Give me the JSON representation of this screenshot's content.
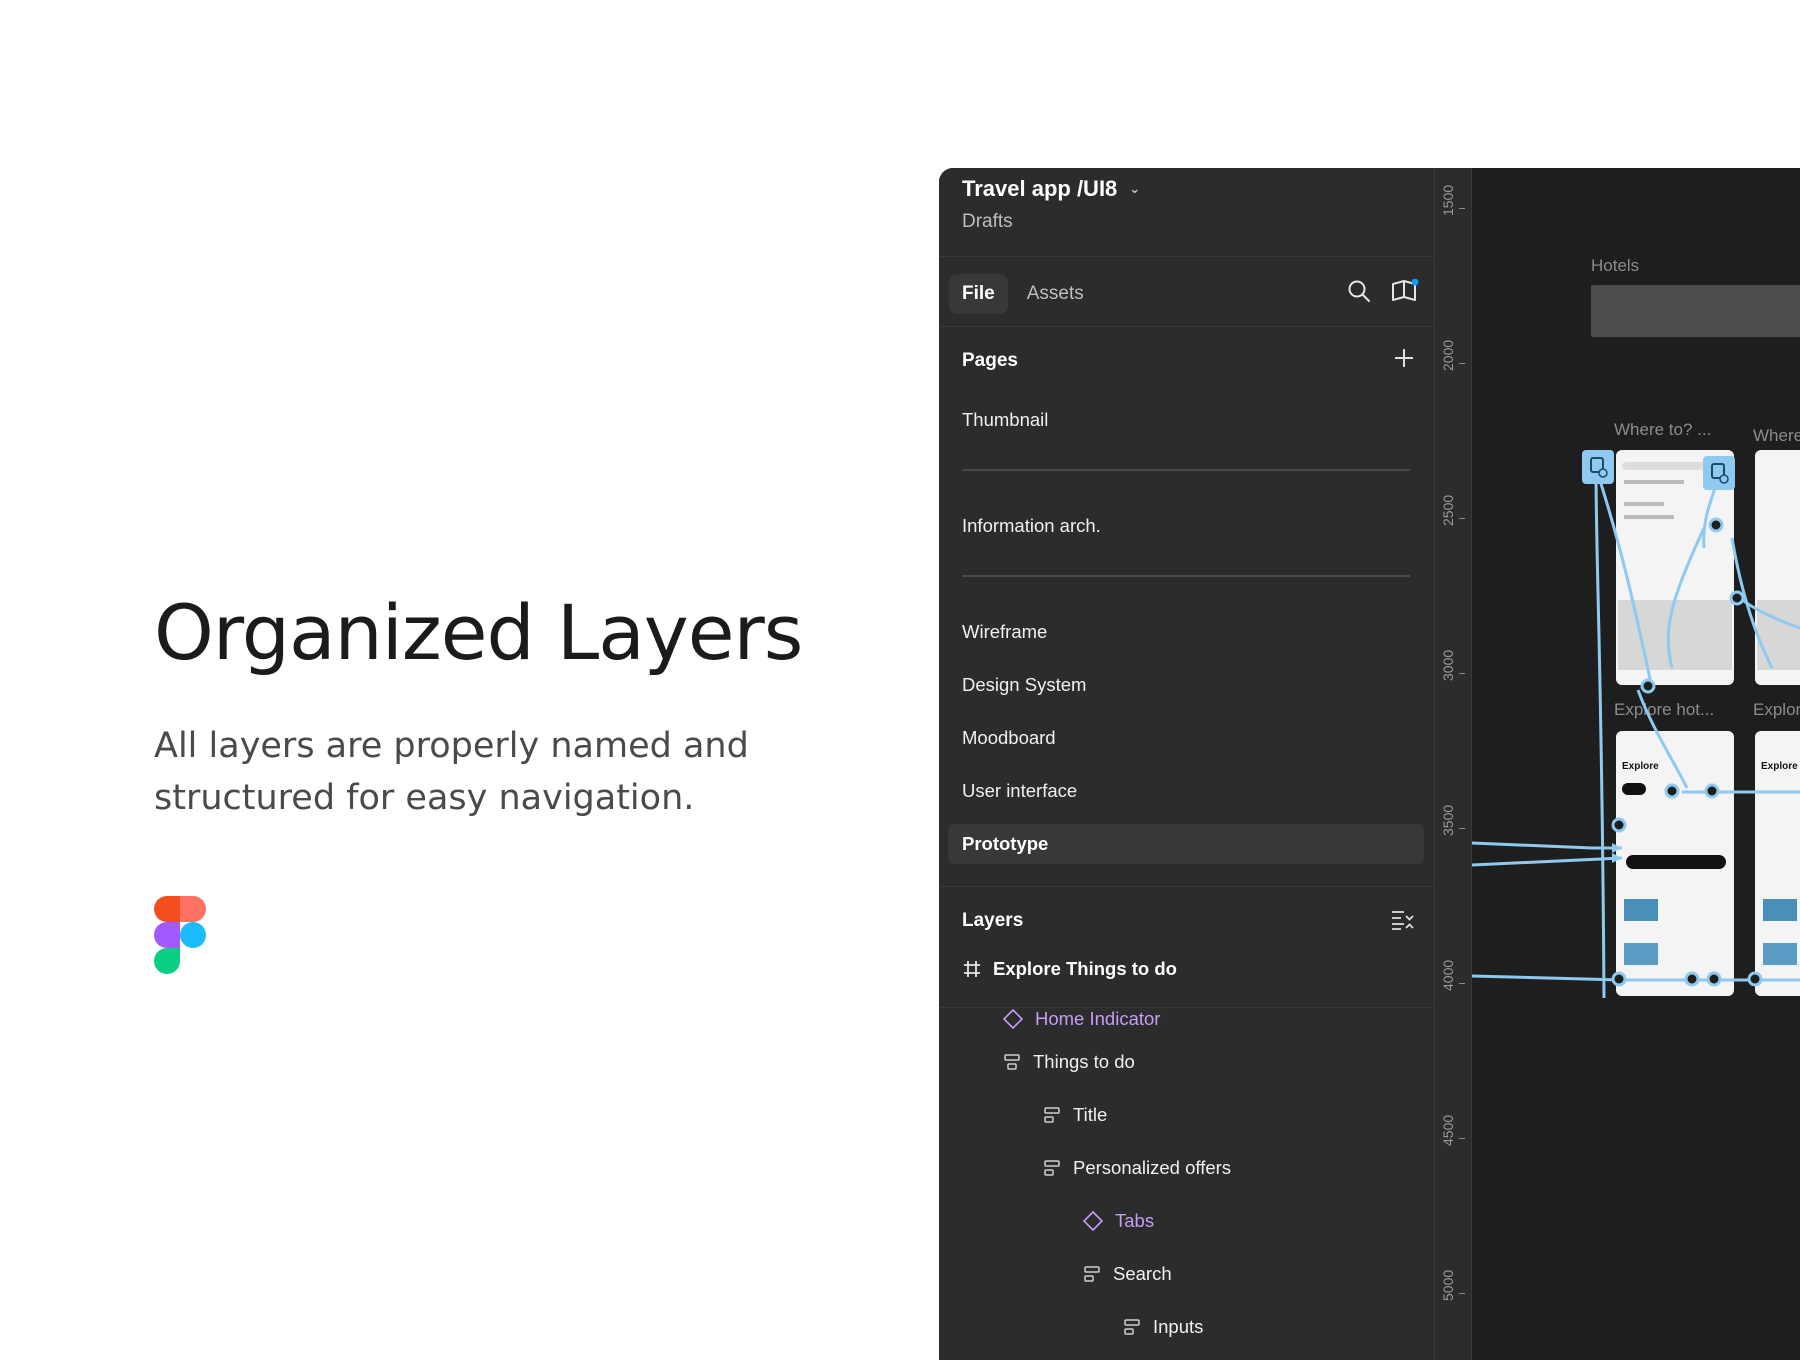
{
  "hero": {
    "title": "Organized Layers",
    "subtitle": "All layers are properly named and structured for easy navigation."
  },
  "brand": {
    "logo_icon": "figma-logo"
  },
  "file": {
    "title": "Travel app /UI8",
    "location": "Drafts"
  },
  "tabs": [
    {
      "label": "File",
      "active": true
    },
    {
      "label": "Assets",
      "active": false
    }
  ],
  "toolbar_icons": [
    "search-icon",
    "library-icon"
  ],
  "pages": {
    "heading": "Pages",
    "add_icon": "plus-icon",
    "items": [
      {
        "label": "Thumbnail"
      },
      {
        "label": "Information arch."
      },
      {
        "label": "Wireframe"
      },
      {
        "label": "Design System"
      },
      {
        "label": "Moodboard"
      },
      {
        "label": "User interface"
      },
      {
        "label": "Prototype",
        "selected": true
      }
    ]
  },
  "layers": {
    "heading": "Layers",
    "collapse_icon": "collapse-layers-icon",
    "items": [
      {
        "label": "Explore Things to do",
        "type": "frame",
        "icon": "frame-icon"
      },
      {
        "label": "Home Indicator",
        "type": "component",
        "icon": "component-instance-icon"
      },
      {
        "label": "Things to do",
        "type": "auto-layout",
        "icon": "auto-layout-icon"
      },
      {
        "label": "Title",
        "type": "auto-layout",
        "icon": "auto-layout-icon"
      },
      {
        "label": "Personalized offers",
        "type": "auto-layout",
        "icon": "auto-layout-icon"
      },
      {
        "label": "Tabs",
        "type": "component",
        "icon": "component-instance-icon"
      },
      {
        "label": "Search",
        "type": "auto-layout",
        "icon": "auto-layout-icon"
      },
      {
        "label": "Inputs",
        "type": "auto-layout",
        "icon": "auto-layout-icon"
      }
    ]
  },
  "ruler": {
    "labels": [
      "1500",
      "2000",
      "2500",
      "3000",
      "3500",
      "4000",
      "4500",
      "5000"
    ]
  },
  "canvas": {
    "frame_labels": [
      "Hotels",
      "Where to? ...",
      "Where",
      "Explore hot...",
      "Explor"
    ],
    "screen_text": [
      "Explore",
      "Explore"
    ]
  },
  "colors": {
    "panel_bg": "#2c2c2c",
    "canvas_bg": "#1e1e1e",
    "component_purple": "#c69cf4",
    "prototype_blue": "#8ec9ef",
    "notification_blue": "#0d99ff"
  }
}
